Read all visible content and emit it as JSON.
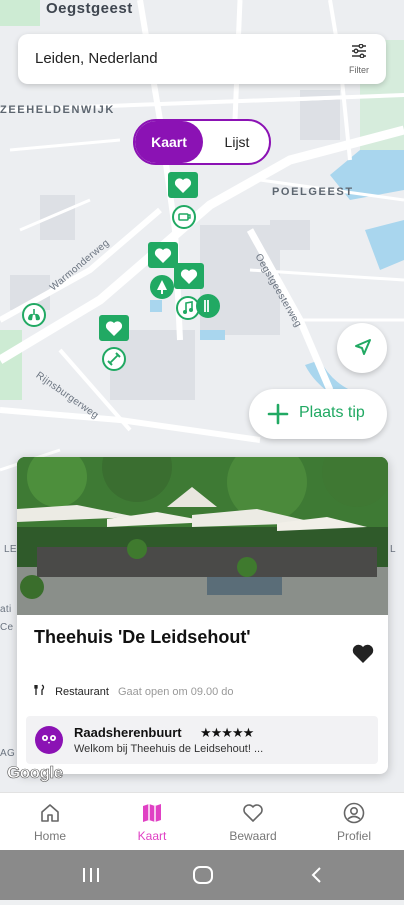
{
  "map": {
    "labels": {
      "oegstgeest": "Oegstgeest",
      "zeeheldenwijk": "ZEEHELDENWIJK",
      "poelgeest": "POELGEEST",
      "warmonderweg": "Warmonderweg",
      "oegstgeesterweg": "Oegstgeesterweg",
      "rijnsburgerweg": "Rijnsburgerweg",
      "edge_left_1": "LE",
      "edge_left_2": "ati",
      "edge_left_3": "Ce",
      "edge_left_4": "AG",
      "edge_right": "L"
    },
    "google_logo": "Google"
  },
  "search": {
    "location": "Leiden, Nederland",
    "filter_label": "Filter",
    "filter_icon": "sliders-icon"
  },
  "view_toggle": {
    "active": "Kaart",
    "inactive": "Lijst"
  },
  "actions": {
    "locate_icon": "navigation-arrow-icon",
    "add_tip_label": "Plaats tip"
  },
  "card": {
    "title": "Theehuis 'De Leidsehout'",
    "category": "Restaurant",
    "hours": "Gaat open om 09.00 do",
    "review": {
      "author": "Raadsherenbuurt",
      "stars": "★★★★★",
      "rating": 5,
      "text": "Welkom bij Theehuis de Leidsehout! ..."
    }
  },
  "bottom_nav": {
    "items": [
      {
        "label": "Home",
        "icon": "home-icon"
      },
      {
        "label": "Kaart",
        "icon": "map-icon"
      },
      {
        "label": "Bewaard",
        "icon": "heart-icon"
      },
      {
        "label": "Profiel",
        "icon": "profile-icon"
      }
    ],
    "active": "Kaart"
  },
  "colors": {
    "brand_purple": "#8b12b4",
    "tip_green": "#21a963",
    "active_pink": "#e041c4"
  }
}
